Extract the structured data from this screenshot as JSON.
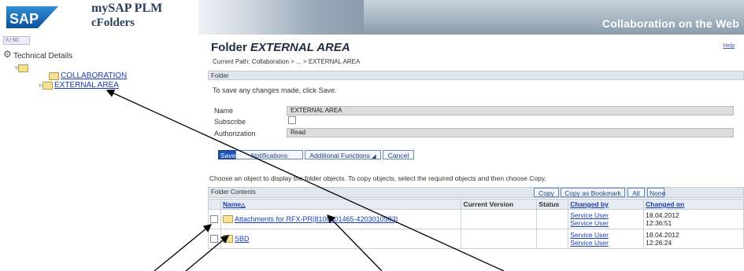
{
  "header": {
    "sap_logo": "SAP",
    "app_name": "mySAP PLM",
    "app_sub": "cFolders",
    "title": "Collaboration on the Web"
  },
  "nav": {
    "toolbar": "IU 60",
    "root_label": "Technical Details",
    "items": [
      {
        "label": "COLLABORATION"
      },
      {
        "label": "EXTERNAL AREA"
      }
    ]
  },
  "main": {
    "title_prefix": "Folder",
    "title_name": "EXTERNAL AREA",
    "help": "Help",
    "current_path": "Current Path:  Collaboration > ... > EXTERNAL AREA",
    "folder_bar": "Folder",
    "save_hint": "To save any changes made, click Save.",
    "form": {
      "name_label": "Name",
      "name_value": "EXTERNAL AREA",
      "subscribe_label": "Subscribe",
      "auth_label": "Authorization",
      "auth_value": "Read"
    },
    "buttons": {
      "save": "Save",
      "notifications": "Notifications",
      "additional": "Additional Functions",
      "cancel": "Cancel"
    },
    "choose_text": "Choose an object to display the folder objects. To copy objects, select the required objects and then choose Copy.",
    "contents_bar": "Folder Contents",
    "contents_buttons": {
      "copy": "Copy",
      "copy_bookmark": "Copy as Bookmark",
      "all": "All",
      "none": "None"
    },
    "table": {
      "columns": [
        "Name",
        "Current Version",
        "Status",
        "Changed by",
        "Changed on"
      ],
      "rows": [
        {
          "name": "Attachments for RFX-PR[8100001465-4203010983]",
          "version": "",
          "status": "",
          "changed_by_1": "Service User",
          "changed_by_2": "Service User",
          "date": "18.04.2012",
          "time": "12:36:51"
        },
        {
          "name": "SBD",
          "version": "",
          "status": "",
          "changed_by_1": "Service User",
          "changed_by_2": "Service User",
          "date": "18.04.2012",
          "time": "12:26:24"
        }
      ]
    }
  },
  "colors": {
    "link": "#1a3db5",
    "header": "#8b9cab",
    "save_button": "#1d52b6"
  }
}
